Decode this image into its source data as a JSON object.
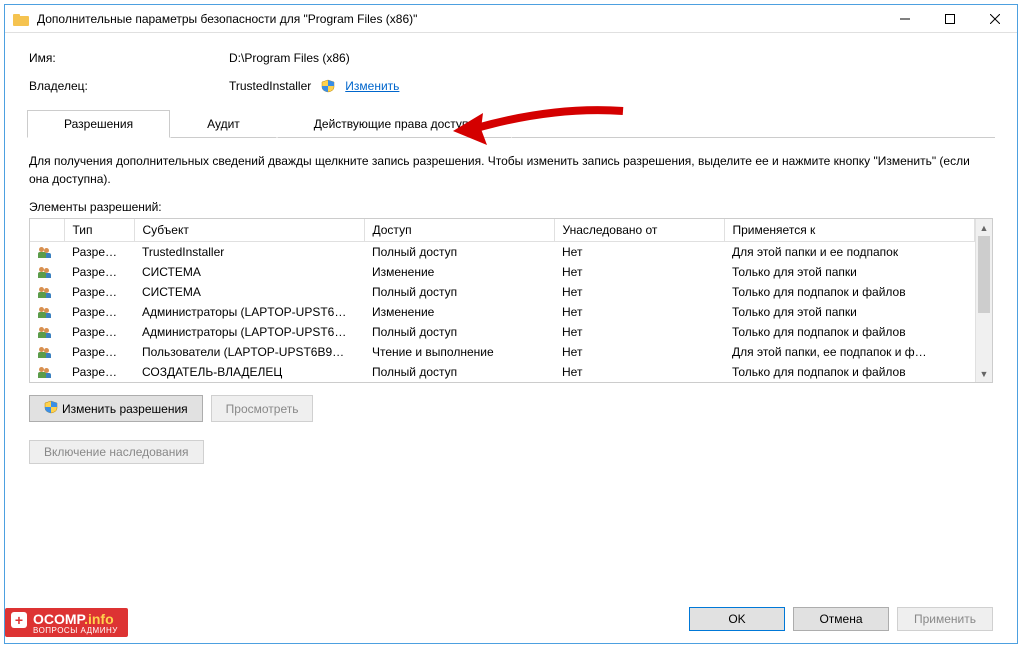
{
  "title": "Дополнительные параметры безопасности  для \"Program Files (x86)\"",
  "fields": {
    "name_label": "Имя:",
    "name_value": "D:\\Program Files (x86)",
    "owner_label": "Владелец:",
    "owner_value": "TrustedInstaller",
    "change_link": "Изменить"
  },
  "tabs": {
    "perm": "Разрешения",
    "audit": "Аудит",
    "effective": "Действующие права доступа"
  },
  "instruction": "Для получения дополнительных сведений дважды щелкните запись разрешения. Чтобы изменить запись разрешения, выделите ее и нажмите кнопку \"Изменить\" (если она доступна).",
  "entries_label": "Элементы разрешений:",
  "columns": {
    "type": "Тип",
    "subject": "Субъект",
    "access": "Доступ",
    "inherited": "Унаследовано от",
    "applies": "Применяется к"
  },
  "rows": [
    {
      "type": "Разре…",
      "subject": "TrustedInstaller",
      "access": "Полный доступ",
      "inherited": "Нет",
      "applies": "Для этой папки и ее подпапок"
    },
    {
      "type": "Разре…",
      "subject": "СИСТЕМА",
      "access": "Изменение",
      "inherited": "Нет",
      "applies": "Только для этой папки"
    },
    {
      "type": "Разре…",
      "subject": "СИСТЕМА",
      "access": "Полный доступ",
      "inherited": "Нет",
      "applies": "Только для подпапок и файлов"
    },
    {
      "type": "Разре…",
      "subject": "Администраторы (LAPTOP-UPST6…",
      "access": "Изменение",
      "inherited": "Нет",
      "applies": "Только для этой папки"
    },
    {
      "type": "Разре…",
      "subject": "Администраторы (LAPTOP-UPST6…",
      "access": "Полный доступ",
      "inherited": "Нет",
      "applies": "Только для подпапок и файлов"
    },
    {
      "type": "Разре…",
      "subject": "Пользователи (LAPTOP-UPST6B9…",
      "access": "Чтение и выполнение",
      "inherited": "Нет",
      "applies": "Для этой папки, ее подпапок и ф…"
    },
    {
      "type": "Разре…",
      "subject": "СОЗДАТЕЛЬ-ВЛАДЕЛЕЦ",
      "access": "Полный доступ",
      "inherited": "Нет",
      "applies": "Только для подпапок и файлов"
    }
  ],
  "buttons": {
    "change_perm": "Изменить разрешения",
    "view": "Просмотреть",
    "enable_inherit": "Включение наследования",
    "ok": "OK",
    "cancel": "Отмена",
    "apply": "Применить"
  },
  "watermark": {
    "main": "OCOMP",
    "suffix": ".info",
    "sub": "ВОПРОСЫ АДМИНУ"
  }
}
